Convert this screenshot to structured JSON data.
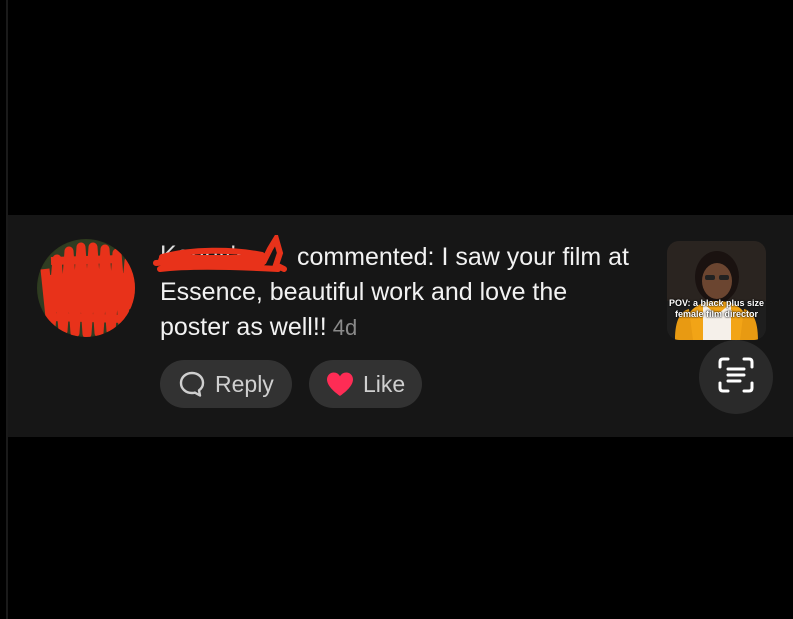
{
  "notification": {
    "username": "Kenny's",
    "action_text": " commented: I saw your film at Essence, beautiful work and love the poster as well!!",
    "time_ago": "4d",
    "buttons": {
      "reply_label": "Reply",
      "like_label": "Like"
    },
    "thumbnail": {
      "caption": "POV: a black plus size female film director"
    },
    "icons": {
      "reply": "speech-bubble-icon",
      "like": "heart-icon",
      "scan": "text-scan-icon"
    },
    "colors": {
      "background": "#000000",
      "card": "#161616",
      "like_heart": "#fe2c55",
      "redaction": "#e8321a"
    }
  }
}
